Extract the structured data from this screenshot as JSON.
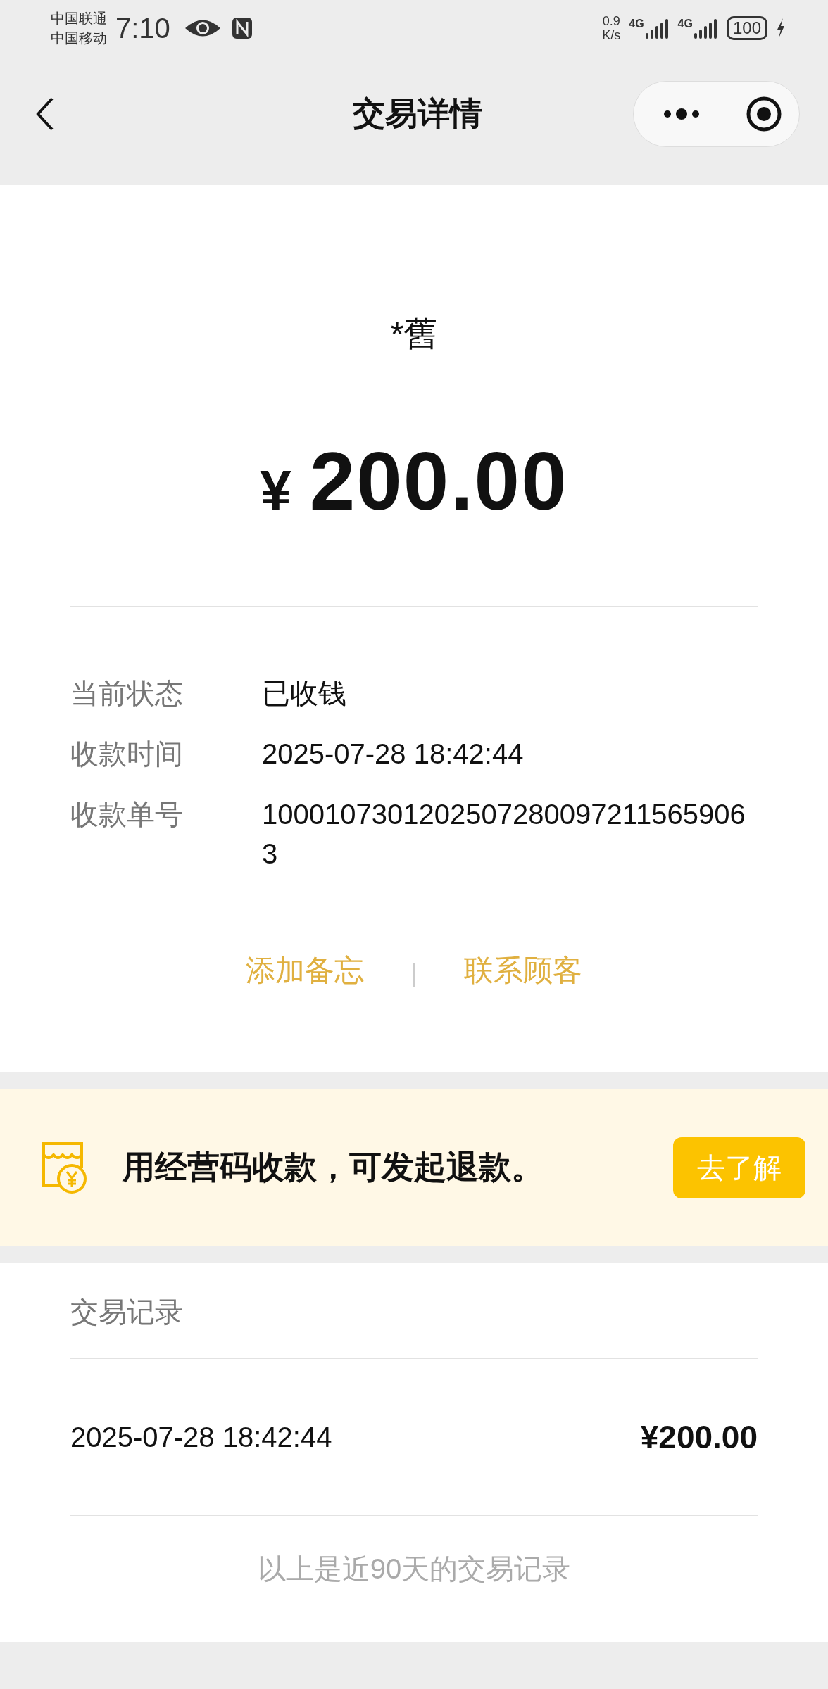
{
  "status_bar": {
    "carriers": [
      "中国联通",
      "中国移动"
    ],
    "time": "7:10",
    "speed_value": "0.9",
    "speed_unit": "K/s",
    "networks": [
      "4G",
      "4G"
    ],
    "battery": "100"
  },
  "header": {
    "title": "交易详情"
  },
  "payer": "*舊",
  "amount": {
    "currency": "¥",
    "value": "200.00"
  },
  "details": [
    {
      "label": "当前状态",
      "value": "已收钱"
    },
    {
      "label": "收款时间",
      "value": "2025-07-28 18:42:44"
    },
    {
      "label": "收款单号",
      "value": "10001073012025072800972115659063"
    }
  ],
  "actions": [
    "添加备忘",
    "联系顾客"
  ],
  "banner": {
    "text": "用经营码收款，可发起退款。",
    "button": "去了解"
  },
  "records": {
    "title": "交易记录",
    "rows": [
      {
        "time": "2025-07-28 18:42:44",
        "amount": "¥200.00"
      }
    ],
    "footer": "以上是近90天的交易记录"
  }
}
